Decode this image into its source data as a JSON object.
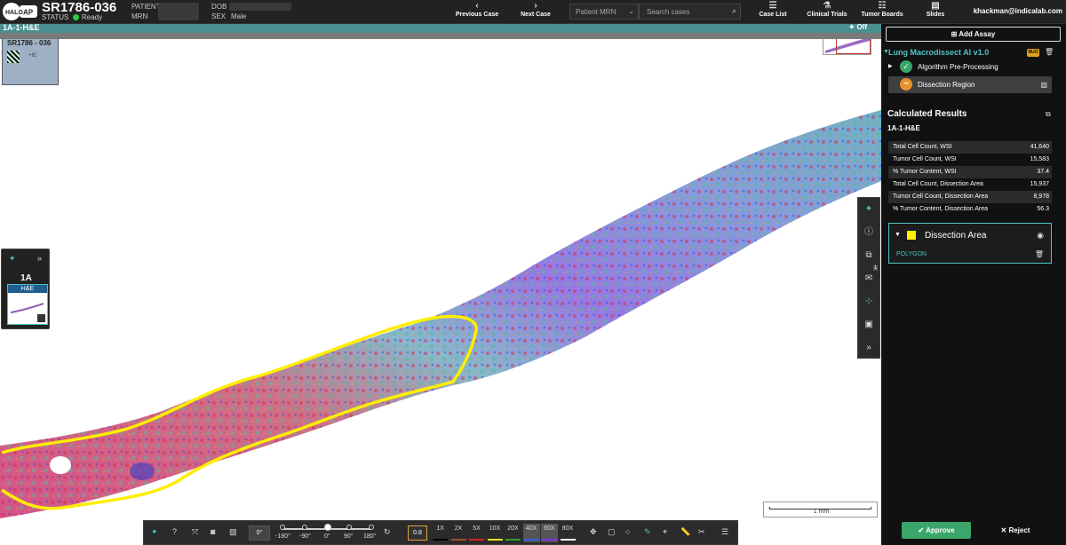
{
  "header": {
    "logo": "HALO AP",
    "case_id": "SR1786-036",
    "status_label": "STATUS",
    "status_value": "Ready",
    "patient_label": "PATIENT",
    "mrn_label": "MRN",
    "dob_label": "DOB",
    "sex_label": "SEX",
    "sex_value": "Male",
    "prev_case": "Previous Case",
    "next_case": "Next Case",
    "mrn_select": "Patient MRN",
    "search_placeholder": "Search cases",
    "case_list": "Case List",
    "clinical_trials": "Clinical Trials",
    "tumor_boards": "Tumor Boards",
    "slides": "Slides",
    "user": "khackman@indicalab.com"
  },
  "viewer": {
    "slide_title": "1A-1-H&E",
    "off_toggle": "Off",
    "label_text": "SR1786 - 036",
    "label_stain": "HE",
    "scale_text": "1 mm"
  },
  "slide_panel": {
    "block": "1A",
    "stain": "H&E"
  },
  "bottom_toolbar": {
    "angle_value": "0°",
    "rotation_labels": [
      "-180°",
      "-90°",
      "0°",
      "90°",
      "180°"
    ],
    "rotation_value_deg": 0,
    "gamma_value": "0.8",
    "zoom_levels": [
      {
        "label": "1X",
        "color": "#000000"
      },
      {
        "label": "2X",
        "color": "#a0522d"
      },
      {
        "label": "5X",
        "color": "#e02020"
      },
      {
        "label": "10X",
        "color": "#f0e020"
      },
      {
        "label": "20X",
        "color": "#2ca02c"
      },
      {
        "label": "40X",
        "color": "#3060e0"
      },
      {
        "label": "60X",
        "color": "#8a2be2"
      },
      {
        "label": "80X",
        "color": "#ffffff"
      }
    ]
  },
  "right_panel": {
    "add_assay": "Add Assay",
    "algorithm": "Lung Macrodissect AI v1.0",
    "ruo_badge": "RUO",
    "steps": [
      "Algorithm Pre-Processing",
      "Dissection Region"
    ],
    "calc_title": "Calculated Results",
    "slide_name": "1A-1-H&E",
    "results": [
      {
        "label": "Total Cell Count, WSI",
        "value": "41,640"
      },
      {
        "label": "Tumor Cell Count, WSI",
        "value": "15,583"
      },
      {
        "label": "% Tumor Content, WSI",
        "value": "37.4"
      },
      {
        "label": "Total Cell Count, Dissection Area",
        "value": "15,937"
      },
      {
        "label": "Tumor Cell Count, Dissection Area",
        "value": "8,978"
      },
      {
        "label": "% Tumor Content, Dissection Area",
        "value": "56.3"
      }
    ],
    "annotation_name": "Dissection Area",
    "annotation_color": "#ffee00",
    "annotation_type": "POLYGON",
    "approve": "Approve",
    "reject": "Reject"
  },
  "vertical_toolbar": {
    "comment_count": "1"
  }
}
